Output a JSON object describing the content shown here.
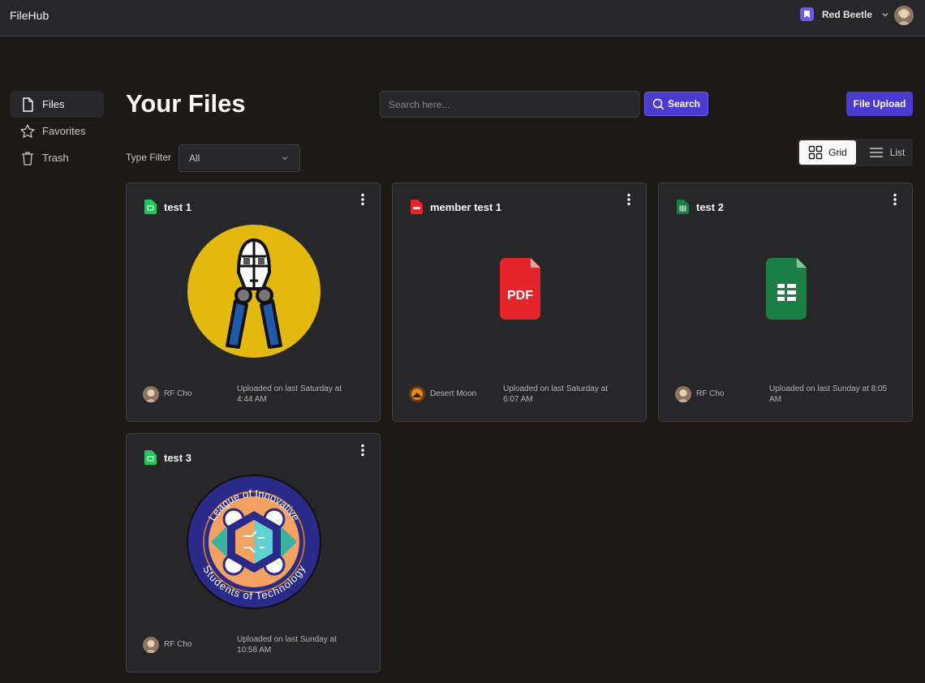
{
  "app": {
    "brand": "FileHub"
  },
  "header": {
    "org_name": "Red Beetle",
    "org_icon": "bookmark-icon",
    "avatar": "user-avatar"
  },
  "sidebar": {
    "items": [
      {
        "label": "Files",
        "icon": "file-icon",
        "active": true
      },
      {
        "label": "Favorites",
        "icon": "star-icon",
        "active": false
      },
      {
        "label": "Trash",
        "icon": "trash-icon",
        "active": false
      }
    ]
  },
  "main": {
    "title": "Your Files",
    "search": {
      "placeholder": "Search here...",
      "value": "",
      "button_label": "Search"
    },
    "upload_label": "File Upload",
    "filter": {
      "label": "Type Filter",
      "selected": "All"
    },
    "view": {
      "grid_label": "Grid",
      "list_label": "List",
      "selected": "Grid"
    }
  },
  "files": [
    {
      "name": "test 1",
      "type": "image",
      "owner": "RF Cho",
      "uploaded": "Uploaded on last Saturday at 4:44 AM"
    },
    {
      "name": "member test 1",
      "type": "pdf",
      "owner": "Desert Moon",
      "uploaded": "Uploaded on last Saturday at 6:07 AM"
    },
    {
      "name": "test 2",
      "type": "spreadsheet",
      "owner": "RF Cho",
      "uploaded": "Uploaded on last Sunday at 8:05 AM"
    },
    {
      "name": "test 3",
      "type": "image",
      "owner": "RF Cho",
      "uploaded": "Uploaded on last Sunday at 10:58 AM"
    }
  ],
  "thumbnail_text": {
    "pdf_label": "PDF",
    "logo_top": "League of Innovative",
    "logo_bottom": "Students of Technology"
  },
  "colors": {
    "accent": "#4a3bd0",
    "background": "#1c1917",
    "card": "#27272a",
    "pdf": "#e5252a",
    "sheet": "#1a7f45",
    "image": "#22c55e"
  }
}
